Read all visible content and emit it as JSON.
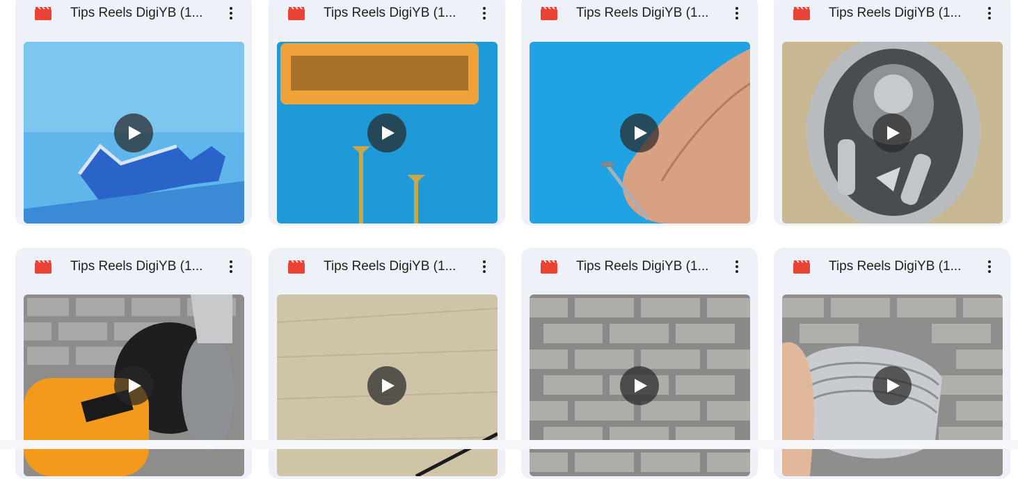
{
  "colors": {
    "card_bg": "#eef1f8",
    "video_icon": "#ea4335",
    "play_overlay": "rgba(40,40,40,0.72)"
  },
  "icons": {
    "file_type": "video-clapper-icon",
    "more": "more-vert-icon",
    "play": "play-icon"
  },
  "files": [
    {
      "title": "Tips Reels DigiYB (1..."
    },
    {
      "title": "Tips Reels DigiYB (1..."
    },
    {
      "title": "Tips Reels DigiYB (1..."
    },
    {
      "title": "Tips Reels DigiYB (1..."
    },
    {
      "title": "Tips Reels DigiYB (1..."
    },
    {
      "title": "Tips Reels DigiYB (1..."
    },
    {
      "title": "Tips Reels DigiYB (1..."
    },
    {
      "title": "Tips Reels DigiYB (1..."
    }
  ]
}
